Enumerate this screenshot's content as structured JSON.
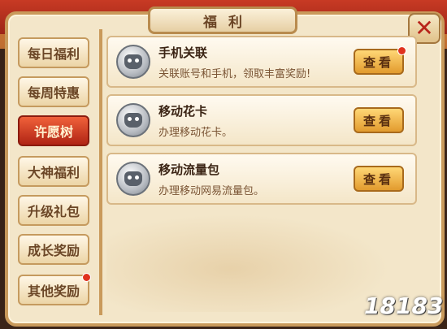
{
  "window": {
    "title": "福利",
    "close_label": "✕"
  },
  "sidebar": {
    "items": [
      {
        "label": "每日福利",
        "active": false,
        "badge": false
      },
      {
        "label": "每周特惠",
        "active": false,
        "badge": false
      },
      {
        "label": "许愿树",
        "active": true,
        "badge": false
      },
      {
        "label": "大神福利",
        "active": false,
        "badge": false
      },
      {
        "label": "升级礼包",
        "active": false,
        "badge": false
      },
      {
        "label": "成长奖励",
        "active": false,
        "badge": false
      },
      {
        "label": "其他奖励",
        "active": false,
        "badge": true
      }
    ]
  },
  "cards": [
    {
      "title": "手机关联",
      "desc": "关联账号和手机，领取丰富奖励!",
      "button": "查看",
      "badge": true,
      "icon": "silver-coin-icon"
    },
    {
      "title": "移动花卡",
      "desc": "办理移动花卡。",
      "button": "查看",
      "badge": false,
      "icon": "silver-coin-icon"
    },
    {
      "title": "移动流量包",
      "desc": "办理移动网易流量包。",
      "button": "查看",
      "badge": false,
      "icon": "silver-coin-icon"
    }
  ],
  "watermark": "18183",
  "colors": {
    "accent_red": "#e0321e",
    "button_gold": "#e29b2e",
    "frame": "#c99a5b"
  }
}
